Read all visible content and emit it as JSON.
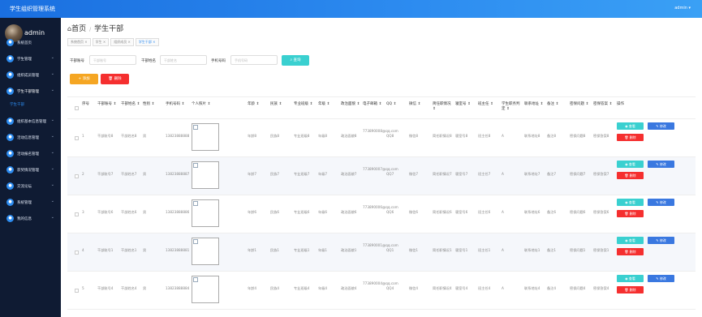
{
  "app": {
    "title": "学生组织管理系统",
    "user": "admin"
  },
  "profile": {
    "name": "admin"
  },
  "sidebar": {
    "items": [
      {
        "label": "系统首页",
        "icon": "home-icon",
        "chevron": ""
      },
      {
        "label": "学生管理",
        "icon": "users-icon",
        "chevron": "⌄"
      },
      {
        "label": "组织成员管理",
        "icon": "group-icon",
        "chevron": "⌄"
      },
      {
        "label": "学生干部管理",
        "icon": "badge-icon",
        "chevron": "⌄"
      },
      {
        "label": "组织基本信息管理",
        "icon": "info-icon",
        "chevron": "⌄"
      },
      {
        "label": "活动信息管理",
        "icon": "calendar-icon",
        "chevron": "⌄"
      },
      {
        "label": "活动报名管理",
        "icon": "signup-icon",
        "chevron": "⌄"
      },
      {
        "label": "获奖情况管理",
        "icon": "trophy-icon",
        "chevron": "⌄"
      },
      {
        "label": "交流论坛",
        "icon": "forum-icon",
        "chevron": "⌄"
      },
      {
        "label": "系统管理",
        "icon": "settings-icon",
        "chevron": "⌄"
      },
      {
        "label": "我的信息",
        "icon": "profile-icon",
        "chevron": "⌄"
      }
    ],
    "sub_label": "学生干部"
  },
  "page": {
    "home": "首页",
    "title": "学生干部"
  },
  "breadcrumb": [
    "系统首页 ×",
    "学生 ×",
    "组织成员 ×",
    "学生干部 ×"
  ],
  "search": {
    "label1": "干部账号",
    "placeholder1": "干部账号",
    "label2": "干部姓名",
    "placeholder2": "干部姓名",
    "label3": "手机号码",
    "placeholder3": "手机号码",
    "button": "查询"
  },
  "actions": {
    "add": "添加",
    "delete": "删除"
  },
  "columns": [
    {
      "label": "序号",
      "sort": ""
    },
    {
      "label": "干部账号",
      "sort": "⇕"
    },
    {
      "label": "干部姓名",
      "sort": "⇕"
    },
    {
      "label": "性别",
      "sort": "⇕"
    },
    {
      "label": "手机号码",
      "sort": "⇕"
    },
    {
      "label": "个人照片",
      "sort": "⇕"
    },
    {
      "label": "年龄",
      "sort": "⇕"
    },
    {
      "label": "民族",
      "sort": "⇕"
    },
    {
      "label": "专业班级",
      "sort": "⇕"
    },
    {
      "label": "年级",
      "sort": "⇕"
    },
    {
      "label": "政治面貌",
      "sort": "⇕"
    },
    {
      "label": "电子邮箱",
      "sort": "⇕"
    },
    {
      "label": "QQ",
      "sort": "⇕"
    },
    {
      "label": "微信",
      "sort": "⇕"
    },
    {
      "label": "简任职情况",
      "sort": "⇕"
    },
    {
      "label": "寝室号",
      "sort": "⇕"
    },
    {
      "label": "班主任",
      "sort": "⇕"
    },
    {
      "label": "学生职务判定",
      "sort": "⇕"
    },
    {
      "label": "联系地址",
      "sort": "⇕"
    },
    {
      "label": "备注",
      "sort": "⇕"
    },
    {
      "label": "密保问题",
      "sort": "⇕"
    },
    {
      "label": "密保答案",
      "sort": "⇕"
    },
    {
      "label": "操作",
      "sort": ""
    }
  ],
  "row_actions": {
    "view": "查看",
    "edit": "修改",
    "delete": "删除"
  },
  "rows": [
    {
      "idx": "1",
      "account": "干部账号8",
      "name": "干部姓名8",
      "gender": "男",
      "phone": "13823888888",
      "age": "年龄8",
      "ethnic": "民族8",
      "major": "专业班级8",
      "grade": "年级8",
      "political": "政治面貌8",
      "email": "773890008@qq.com",
      "qq": "QQ8",
      "wechat": "微信8",
      "history": "简任职情况8",
      "dorm": "寝室号8",
      "teacher": "班主任8",
      "duty": "A",
      "address": "联系地址8",
      "note": "备注8",
      "question": "密保问题8",
      "answer": "密保答案8"
    },
    {
      "idx": "2",
      "account": "干部账号7",
      "name": "干部姓名7",
      "gender": "男",
      "phone": "13823888887",
      "age": "年龄7",
      "ethnic": "民族7",
      "major": "专业班级7",
      "grade": "年级7",
      "political": "政治面貌7",
      "email": "773890007@qq.com",
      "qq": "QQ7",
      "wechat": "微信7",
      "history": "简任职情况7",
      "dorm": "寝室号7",
      "teacher": "班主任7",
      "duty": "A",
      "address": "联系地址7",
      "note": "备注7",
      "question": "密保问题7",
      "answer": "密保答案7"
    },
    {
      "idx": "3",
      "account": "干部账号6",
      "name": "干部姓名6",
      "gender": "男",
      "phone": "13823888886",
      "age": "年龄6",
      "ethnic": "民族6",
      "major": "专业班级6",
      "grade": "年级6",
      "political": "政治面貌6",
      "email": "773890006@qq.com",
      "qq": "QQ6",
      "wechat": "微信6",
      "history": "简任职情况6",
      "dorm": "寝室号6",
      "teacher": "班主任6",
      "duty": "A",
      "address": "联系地址6",
      "note": "备注6",
      "question": "密保问题6",
      "answer": "密保答案6"
    },
    {
      "idx": "4",
      "account": "干部账号1",
      "name": "干部姓名1",
      "gender": "男",
      "phone": "13823888881",
      "age": "年龄1",
      "ethnic": "民族1",
      "major": "专业班级1",
      "grade": "年级1",
      "political": "政治面貌1",
      "email": "773890001@qq.com",
      "qq": "QQ1",
      "wechat": "微信1",
      "history": "简任职情况1",
      "dorm": "寝室号1",
      "teacher": "班主任1",
      "duty": "A",
      "address": "联系地址1",
      "note": "备注1",
      "question": "密保问题1",
      "answer": "密保答案1"
    },
    {
      "idx": "5",
      "account": "干部账号4",
      "name": "干部姓名4",
      "gender": "男",
      "phone": "13823888884",
      "age": "年龄4",
      "ethnic": "民族4",
      "major": "专业班级4",
      "grade": "年级4",
      "political": "政治面貌4",
      "email": "773890004@qq.com",
      "qq": "QQ4",
      "wechat": "微信4",
      "history": "简任职情况4",
      "dorm": "寝室号4",
      "teacher": "班主任4",
      "duty": "A",
      "address": "联系地址4",
      "note": "备注4",
      "question": "密保问题4",
      "answer": "密保答案4"
    }
  ]
}
